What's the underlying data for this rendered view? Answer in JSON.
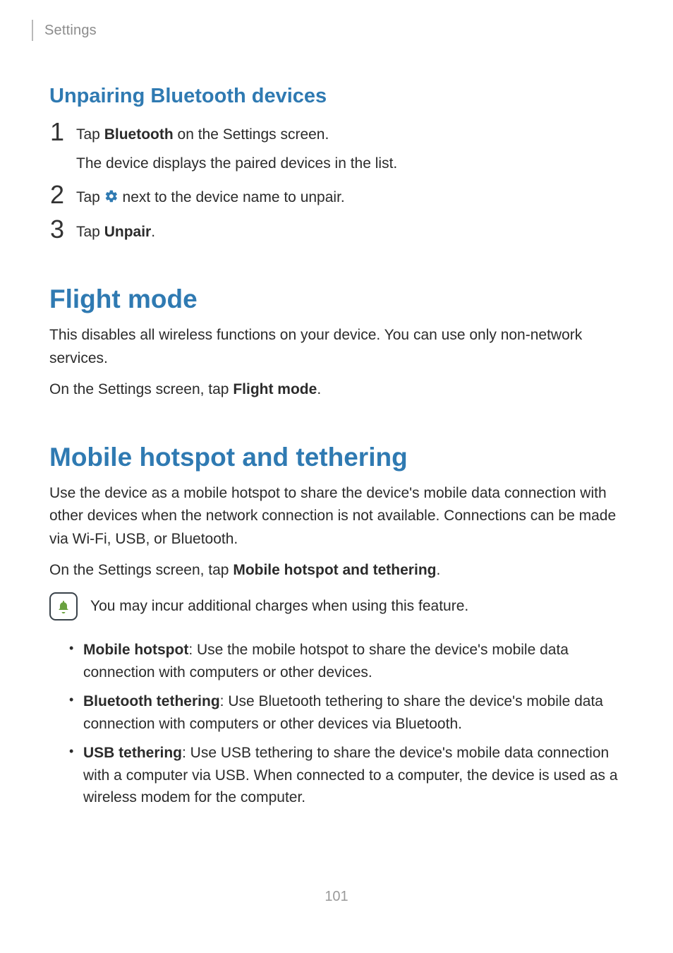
{
  "breadcrumb": "Settings",
  "pageNumber": "101",
  "unpairing": {
    "title": "Unpairing Bluetooth devices",
    "steps": [
      {
        "num": "1",
        "pre": "Tap ",
        "bold": "Bluetooth",
        "post": " on the Settings screen.",
        "sub": "The device displays the paired devices in the list."
      },
      {
        "num": "2",
        "pre": "Tap ",
        "iconName": "gear-icon",
        "post": " next to the device name to unpair."
      },
      {
        "num": "3",
        "pre": "Tap ",
        "bold": "Unpair",
        "post": "."
      }
    ]
  },
  "flight": {
    "title": "Flight mode",
    "p1": "This disables all wireless functions on your device. You can use only non-network services.",
    "p2_pre": "On the Settings screen, tap ",
    "p2_bold": "Flight mode",
    "p2_post": "."
  },
  "hotspot": {
    "title": "Mobile hotspot and tethering",
    "p1": "Use the device as a mobile hotspot to share the device's mobile data connection with other devices when the network connection is not available. Connections can be made via Wi-Fi, USB, or Bluetooth.",
    "p2_pre": "On the Settings screen, tap ",
    "p2_bold": "Mobile hotspot and tethering",
    "p2_post": ".",
    "note": "You may incur additional charges when using this feature.",
    "items": [
      {
        "bold": "Mobile hotspot",
        "rest": ": Use the mobile hotspot to share the device's mobile data connection with computers or other devices."
      },
      {
        "bold": "Bluetooth tethering",
        "rest": ": Use Bluetooth tethering to share the device's mobile data connection with computers or other devices via Bluetooth."
      },
      {
        "bold": "USB tethering",
        "rest": ": Use USB tethering to share the device's mobile data connection with a computer via USB. When connected to a computer, the device is used as a wireless modem for the computer."
      }
    ]
  }
}
